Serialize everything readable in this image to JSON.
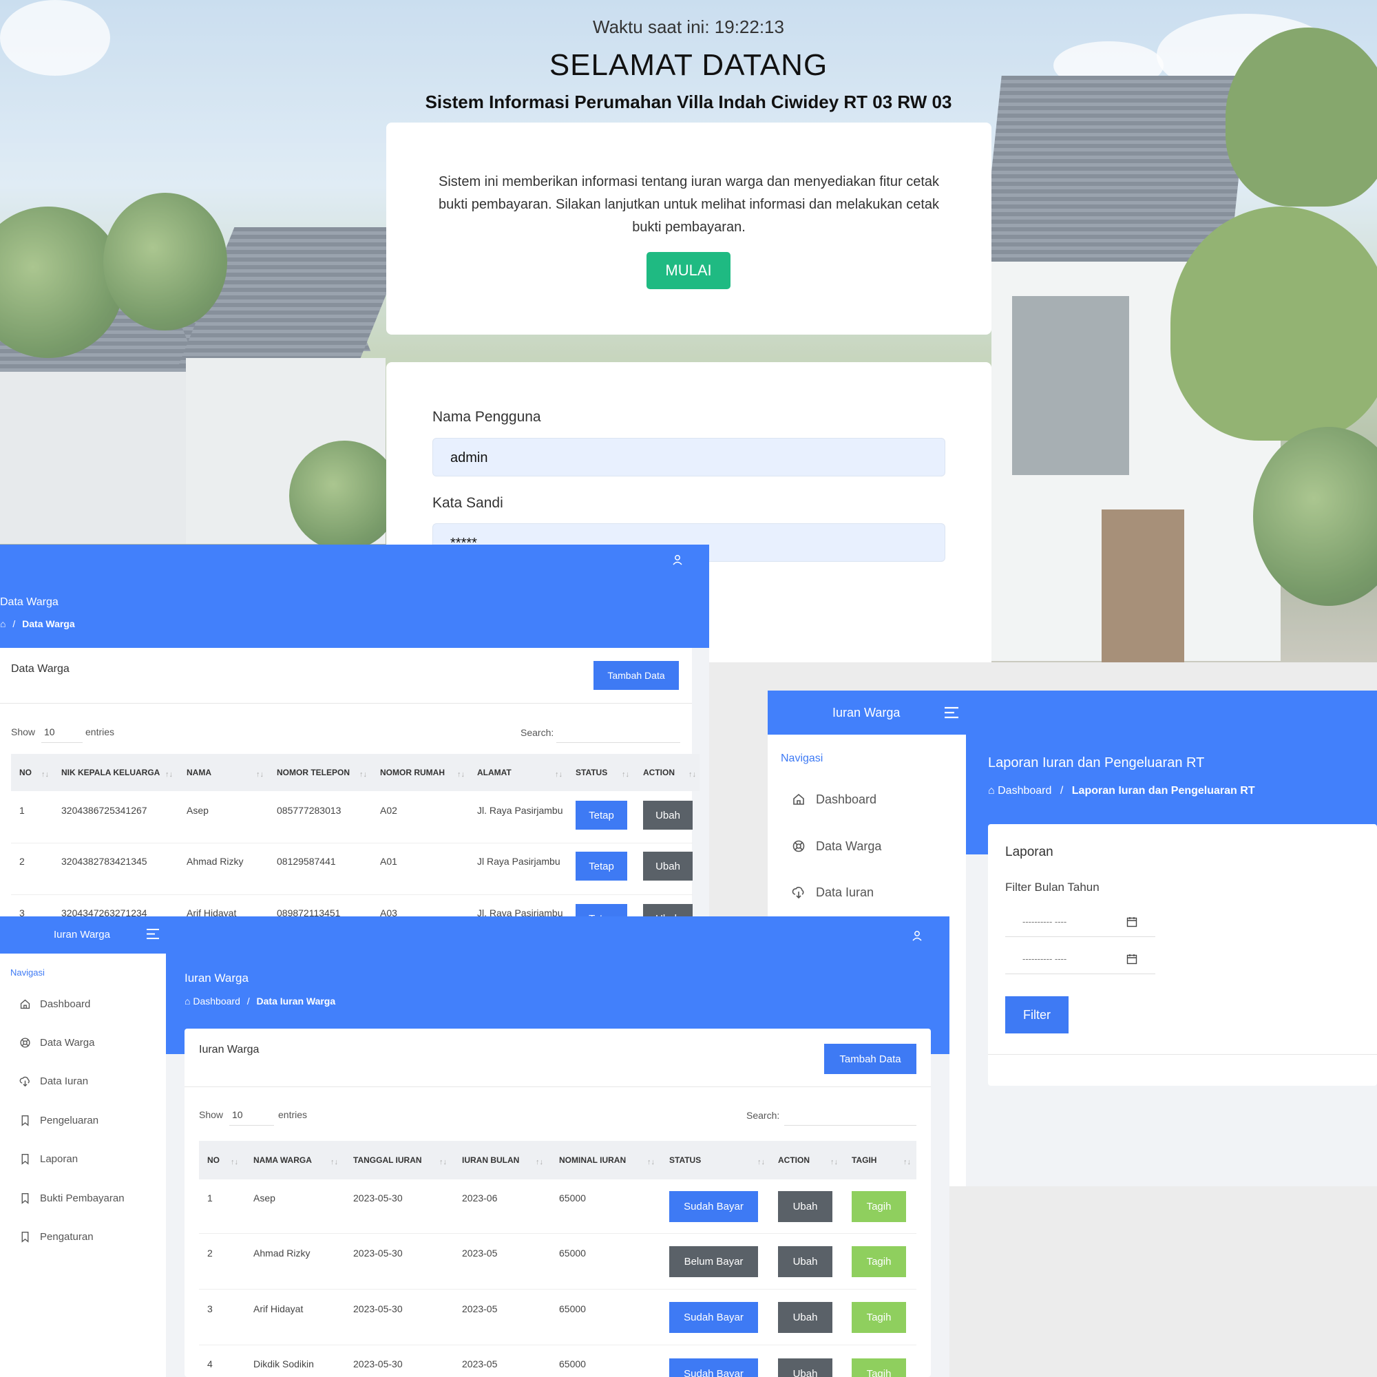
{
  "welcome": {
    "clock_text": "Waktu saat ini: 19:22:13",
    "heading": "SELAMAT DATANG",
    "subtitle": "Sistem Informasi Perumahan Villa Indah Ciwidey RT 03 RW 03",
    "description": "Sistem ini memberikan informasi tentang iuran warga dan menyediakan fitur cetak bukti pembayaran. Silakan lanjutkan untuk melihat informasi dan melakukan cetak bukti pembayaran.",
    "start_button": "MULAI",
    "accent_color": "#1fba82"
  },
  "login": {
    "username_label": "Nama Pengguna",
    "username_value": "admin",
    "password_label": "Kata Sandi",
    "password_value": "*****"
  },
  "data_warga": {
    "page_title": "Data Warga",
    "breadcrumb_current": "Data Warga",
    "card_title": "Data Warga",
    "add_button": "Tambah Data",
    "show_label": "Show",
    "show_value": "10",
    "entries_label": "entries",
    "search_label": "Search:",
    "columns": [
      "NO",
      "NIK KEPALA KELUARGA",
      "NAMA",
      "NOMOR TELEPON",
      "NOMOR RUMAH",
      "ALAMAT",
      "STATUS",
      "ACTION"
    ],
    "rows": [
      {
        "no": "1",
        "nik": "3204386725341267",
        "nama": "Asep",
        "telepon": "085777283013",
        "rumah": "A02",
        "alamat": "Jl. Raya Pasirjambu",
        "status": "Tetap",
        "action": "Ubah"
      },
      {
        "no": "2",
        "nik": "3204382783421345",
        "nama": "Ahmad Rizky",
        "telepon": "08129587441",
        "rumah": "A01",
        "alamat": "Jl Raya Pasirjambu",
        "status": "Tetap",
        "action": "Ubah"
      },
      {
        "no": "3",
        "nik": "3204347263271234",
        "nama": "Arif Hidayat",
        "telepon": "089872113451",
        "rumah": "A03",
        "alamat": "Jl. Raya Pasirjambu",
        "status": "Tetap",
        "action": "Ubah"
      }
    ],
    "header_color": "#4280fb"
  },
  "laporan": {
    "brand": "Iuran Warga",
    "nav_heading": "Navigasi",
    "nav_items": [
      "Dashboard",
      "Data Warga",
      "Data Iuran"
    ],
    "page_title": "Laporan Iuran dan Pengeluaran RT",
    "breadcrumb_home": "Dashboard",
    "breadcrumb_current": "Laporan Iuran dan Pengeluaran RT",
    "card_title": "Laporan",
    "filter_label": "Filter Bulan Tahun",
    "date_placeholder": "---------- ----",
    "filter_button": "Filter"
  },
  "iuran": {
    "brand": "Iuran Warga",
    "nav_heading": "Navigasi",
    "nav_items": [
      "Dashboard",
      "Data Warga",
      "Data Iuran",
      "Pengeluaran",
      "Laporan",
      "Bukti Pembayaran",
      "Pengaturan"
    ],
    "page_title": "Iuran Warga",
    "breadcrumb_home": "Dashboard",
    "breadcrumb_current": "Data Iuran Warga",
    "card_title": "Iuran Warga",
    "add_button": "Tambah Data",
    "show_label": "Show",
    "show_value": "10",
    "entries_label": "entries",
    "search_label": "Search:",
    "columns": [
      "NO",
      "NAMA WARGA",
      "TANGGAL IURAN",
      "IURAN BULAN",
      "NOMINAL IURAN",
      "STATUS",
      "ACTION",
      "TAGIH"
    ],
    "rows": [
      {
        "no": "1",
        "nama": "Asep",
        "tanggal": "2023-05-30",
        "bulan": "2023-06",
        "nominal": "65000",
        "status": "Sudah Bayar",
        "action": "Ubah",
        "tagih": "Tagih"
      },
      {
        "no": "2",
        "nama": "Ahmad Rizky",
        "tanggal": "2023-05-30",
        "bulan": "2023-05",
        "nominal": "65000",
        "status": "Belum Bayar",
        "action": "Ubah",
        "tagih": "Tagih"
      },
      {
        "no": "3",
        "nama": "Arif Hidayat",
        "tanggal": "2023-05-30",
        "bulan": "2023-05",
        "nominal": "65000",
        "status": "Sudah Bayar",
        "action": "Ubah",
        "tagih": "Tagih"
      },
      {
        "no": "4",
        "nama": "Dikdik Sodikin",
        "tanggal": "2023-05-30",
        "bulan": "2023-05",
        "nominal": "65000",
        "status": "Sudah Bayar",
        "action": "Ubah",
        "tagih": "Tagih"
      }
    ]
  }
}
